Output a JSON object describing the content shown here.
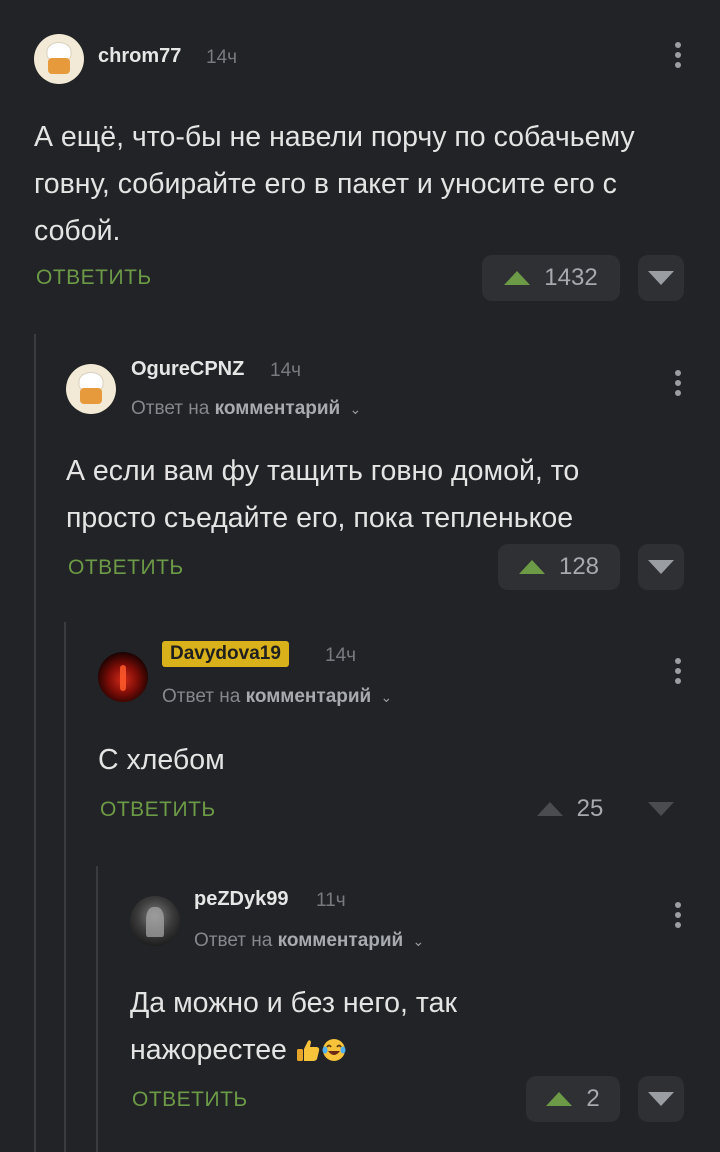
{
  "comments": [
    {
      "username": "chrom77",
      "time": "14ч",
      "text": "А ещё, что-бы не навели порчу по собачьему говну, собирайте его в пакет и уносите его с собой.",
      "reply_label": "ОТВЕТИТЬ",
      "rating": "1432"
    },
    {
      "username": "OgureCPNZ",
      "time": "14ч",
      "reply_to_prefix": "Ответ на",
      "reply_to_target": "комментарий",
      "text": "А если вам фу тащить говно домой, то просто съедайте его, пока тепленькое",
      "reply_label": "ОТВЕТИТЬ",
      "rating": "128"
    },
    {
      "username": "Davydova19",
      "time": "14ч",
      "reply_to_prefix": "Ответ на",
      "reply_to_target": "комментарий",
      "text": "С хлебом",
      "reply_label": "ОТВЕТИТЬ",
      "rating": "25"
    },
    {
      "username": "peZDyk99",
      "time": "11ч",
      "reply_to_prefix": "Ответ на",
      "reply_to_target": "комментарий",
      "text": "Да можно и без него, так нажорестее",
      "reply_label": "ОТВЕТИТЬ",
      "rating": "2"
    }
  ],
  "icons": {
    "more": "kebab-menu-icon",
    "upvote": "arrow-up-icon",
    "downvote": "arrow-down-icon",
    "chevron": "chevron-down-icon",
    "emoji_1": "thumbs-up-emoji",
    "emoji_2": "laughing-tears-emoji"
  },
  "colors": {
    "background": "#222326",
    "accent_green": "#6c9a46",
    "badge": "#d8b11b"
  }
}
